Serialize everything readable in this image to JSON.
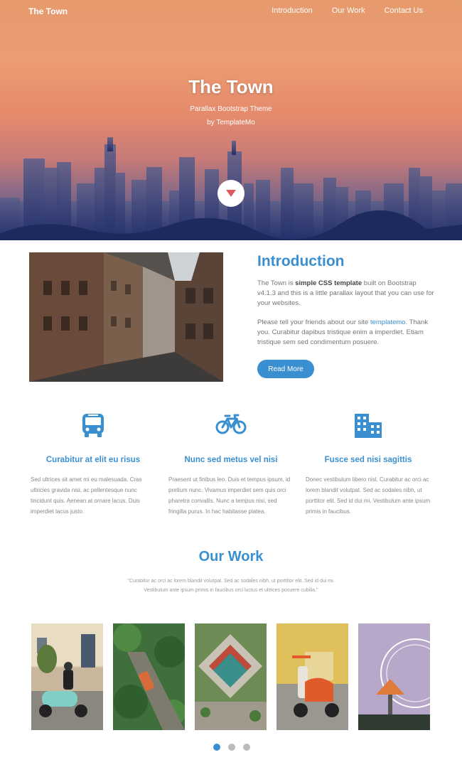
{
  "nav": {
    "brand": "The Town",
    "links": [
      "Introduction",
      "Our Work",
      "Contact Us"
    ]
  },
  "hero": {
    "title": "The Town",
    "subtitle_line1": "Parallax Bootstrap Theme",
    "subtitle_line2": "by TemplateMo",
    "scroll_icon": "triangle-down-icon"
  },
  "intro": {
    "title": "Introduction",
    "p1_before": "The Town is ",
    "p1_bold": "simple CSS template",
    "p1_after": " built on Bootstrap v4.1.3 and this is a little parallax layout that you can use for your websites.",
    "p2_before": "Please tell your friends about our site ",
    "p2_link": "templatemo",
    "p2_after": ". Thank you. Curabitur dapibus tristique enim a imperdiet. Etiam tristique sem sed condimentum posuere.",
    "button_label": "Read More"
  },
  "features": [
    {
      "icon": "bus-icon",
      "title": "Curabitur at elit eu risus",
      "text": "Sed ultrices sit amet mi eu malesuada. Cras ultricies gravida nisi, ac pellentesque nunc tincidunt quis. Aenean at ornare lacus. Duis imperdiet lacus justo."
    },
    {
      "icon": "bicycle-icon",
      "title": "Nunc sed metus vel nisi",
      "text": "Praesent ut finibus leo. Duis et tempus ipsum, id pretium nunc. Vivamus imperdiet sem quis orci pharetra convallis. Nunc a tempus nisi, sed fringilla purus. In hac habitasse platea."
    },
    {
      "icon": "city-icon",
      "title": "Fusce sed nisi sagittis",
      "text": "Donec vestibulum libero nisl. Curabitur ac orci ac lorem blandit volutpat. Sed ac sodales nibh, ut porttitor elit. Sed id dui mi. Vestibulum ante ipsum primis in faucibus."
    }
  ],
  "work": {
    "title": "Our Work",
    "quote": "\"Curabitur ac orci ac lorem blandit volutpat. Sed ac sodales nibh, ut porttitor elit. Sed id dui mi. Vestibulum ante ipsum primis in faucibus orci luctus et ultrices posuere cubilia.\"",
    "gallery": [
      "scooter-rider-photo",
      "aerial-street-photo",
      "aerial-courtyard-photo",
      "red-vespa-photo",
      "ferris-wheel-photo"
    ],
    "active_slide": 1,
    "slide_count": 3
  },
  "colors": {
    "accent": "#3a8fd0",
    "hero_top": "#e59a6c",
    "hero_bottom": "#3e4a7c"
  }
}
